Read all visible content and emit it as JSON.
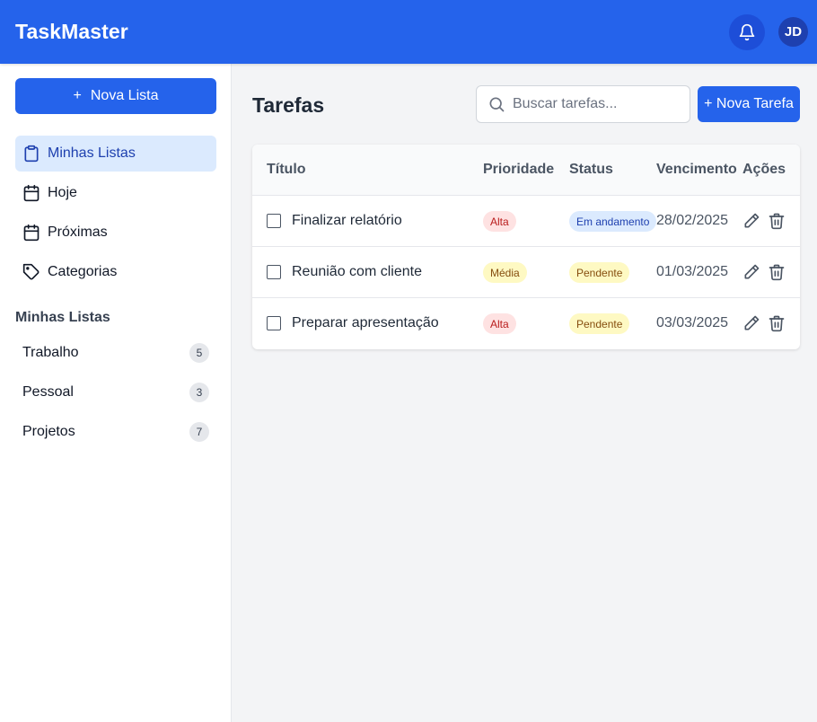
{
  "app": {
    "title": "TaskMaster",
    "avatar_initials": "JD"
  },
  "sidebar": {
    "new_list_icon": "+",
    "new_list_label": "Nova Lista",
    "nav": [
      {
        "label": "Minhas Listas",
        "icon": "clipboard-icon",
        "active": true
      },
      {
        "label": "Hoje",
        "icon": "calendar-icon",
        "active": false
      },
      {
        "label": "Próximas",
        "icon": "calendar-icon",
        "active": false
      },
      {
        "label": "Categorias",
        "icon": "tag-icon",
        "active": false
      }
    ],
    "section_title": "Minhas Listas",
    "lists": [
      {
        "name": "Trabalho",
        "count": "5"
      },
      {
        "name": "Pessoal",
        "count": "3"
      },
      {
        "name": "Projetos",
        "count": "7"
      }
    ]
  },
  "main": {
    "title": "Tarefas",
    "search_placeholder": "Buscar tarefas...",
    "new_task_label": "+ Nova Tarefa",
    "columns": [
      "Título",
      "Prioridade",
      "Status",
      "Vencimento",
      "Ações"
    ],
    "tasks": [
      {
        "title": "Finalizar relatório",
        "priority": "Alta",
        "status": "Em andamento",
        "due": "28/02/2025",
        "checked": false
      },
      {
        "title": "Reunião com cliente",
        "priority": "Média",
        "status": "Pendente",
        "due": "01/03/2025",
        "checked": false
      },
      {
        "title": "Preparar apresentação",
        "priority": "Alta",
        "status": "Pendente",
        "due": "03/03/2025",
        "checked": false
      }
    ]
  },
  "colors": {
    "accent": "#2563eb",
    "priority_high_bg": "#fee2e2",
    "priority_high_fg": "#b91c1c",
    "priority_medium_bg": "#fef9c3",
    "priority_medium_fg": "#854d0e",
    "status_progress_bg": "#dbeafe",
    "status_progress_fg": "#1e40af",
    "status_pending_bg": "#fef9c3",
    "status_pending_fg": "#854d0e"
  }
}
